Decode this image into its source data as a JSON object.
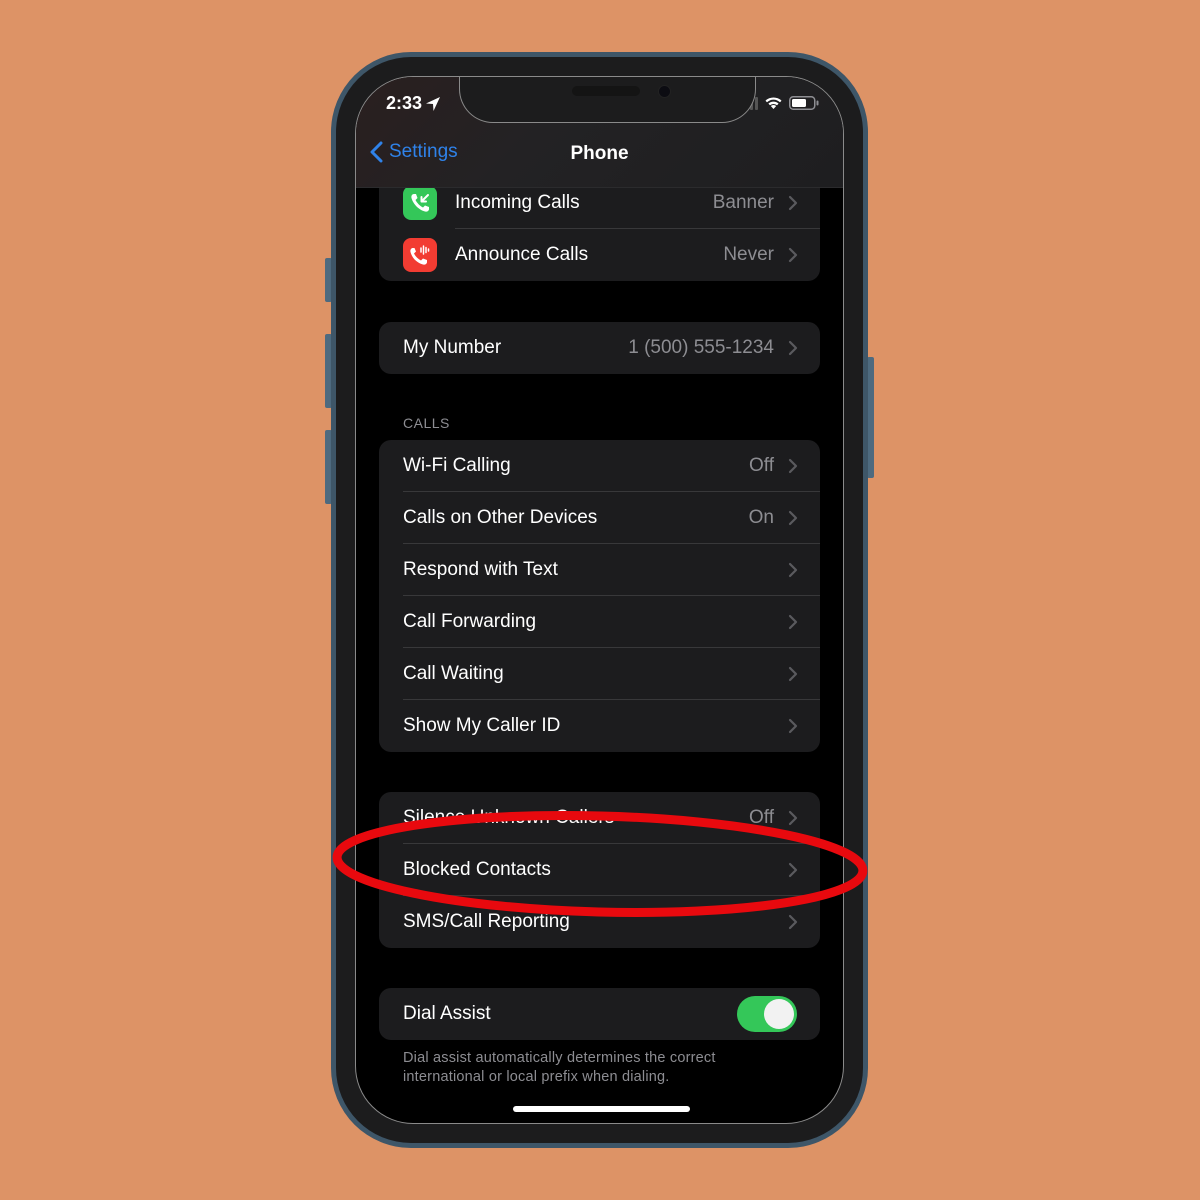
{
  "status_bar": {
    "time": "2:33",
    "location_icon": "location-arrow-icon",
    "signal_icon": "cellular-signal-icon",
    "wifi_icon": "wifi-icon",
    "battery_icon": "battery-icon"
  },
  "nav": {
    "back_label": "Settings",
    "title": "Phone"
  },
  "groups": {
    "notifications": [
      {
        "label": "Incoming Calls",
        "value": "Banner",
        "icon": "incoming-call-icon",
        "icon_color": "#34c759"
      },
      {
        "label": "Announce Calls",
        "value": "Never",
        "icon": "announce-call-icon",
        "icon_color": "#ff3b30"
      }
    ],
    "number": [
      {
        "label": "My Number",
        "value": "1 (500) 555-1234"
      }
    ],
    "calls_header": "CALLS",
    "calls": [
      {
        "label": "Wi-Fi Calling",
        "value": "Off"
      },
      {
        "label": "Calls on Other Devices",
        "value": "On"
      },
      {
        "label": "Respond with Text",
        "value": ""
      },
      {
        "label": "Call Forwarding",
        "value": ""
      },
      {
        "label": "Call Waiting",
        "value": ""
      },
      {
        "label": "Show My Caller ID",
        "value": ""
      }
    ],
    "blocking": [
      {
        "label": "Silence Unknown Callers",
        "value": "Off"
      },
      {
        "label": "Blocked Contacts",
        "value": ""
      },
      {
        "label": "SMS/Call Reporting",
        "value": ""
      }
    ],
    "dial_assist": {
      "label": "Dial Assist",
      "enabled": true,
      "footer": "Dial assist automatically determines the correct international or local prefix when dialing."
    }
  },
  "annotation": {
    "target": "Blocked Contacts",
    "color": "#e8090e"
  },
  "colors": {
    "background": "#dd9366",
    "accent_blue": "#2f82e9",
    "toggle_on": "#34c759"
  }
}
